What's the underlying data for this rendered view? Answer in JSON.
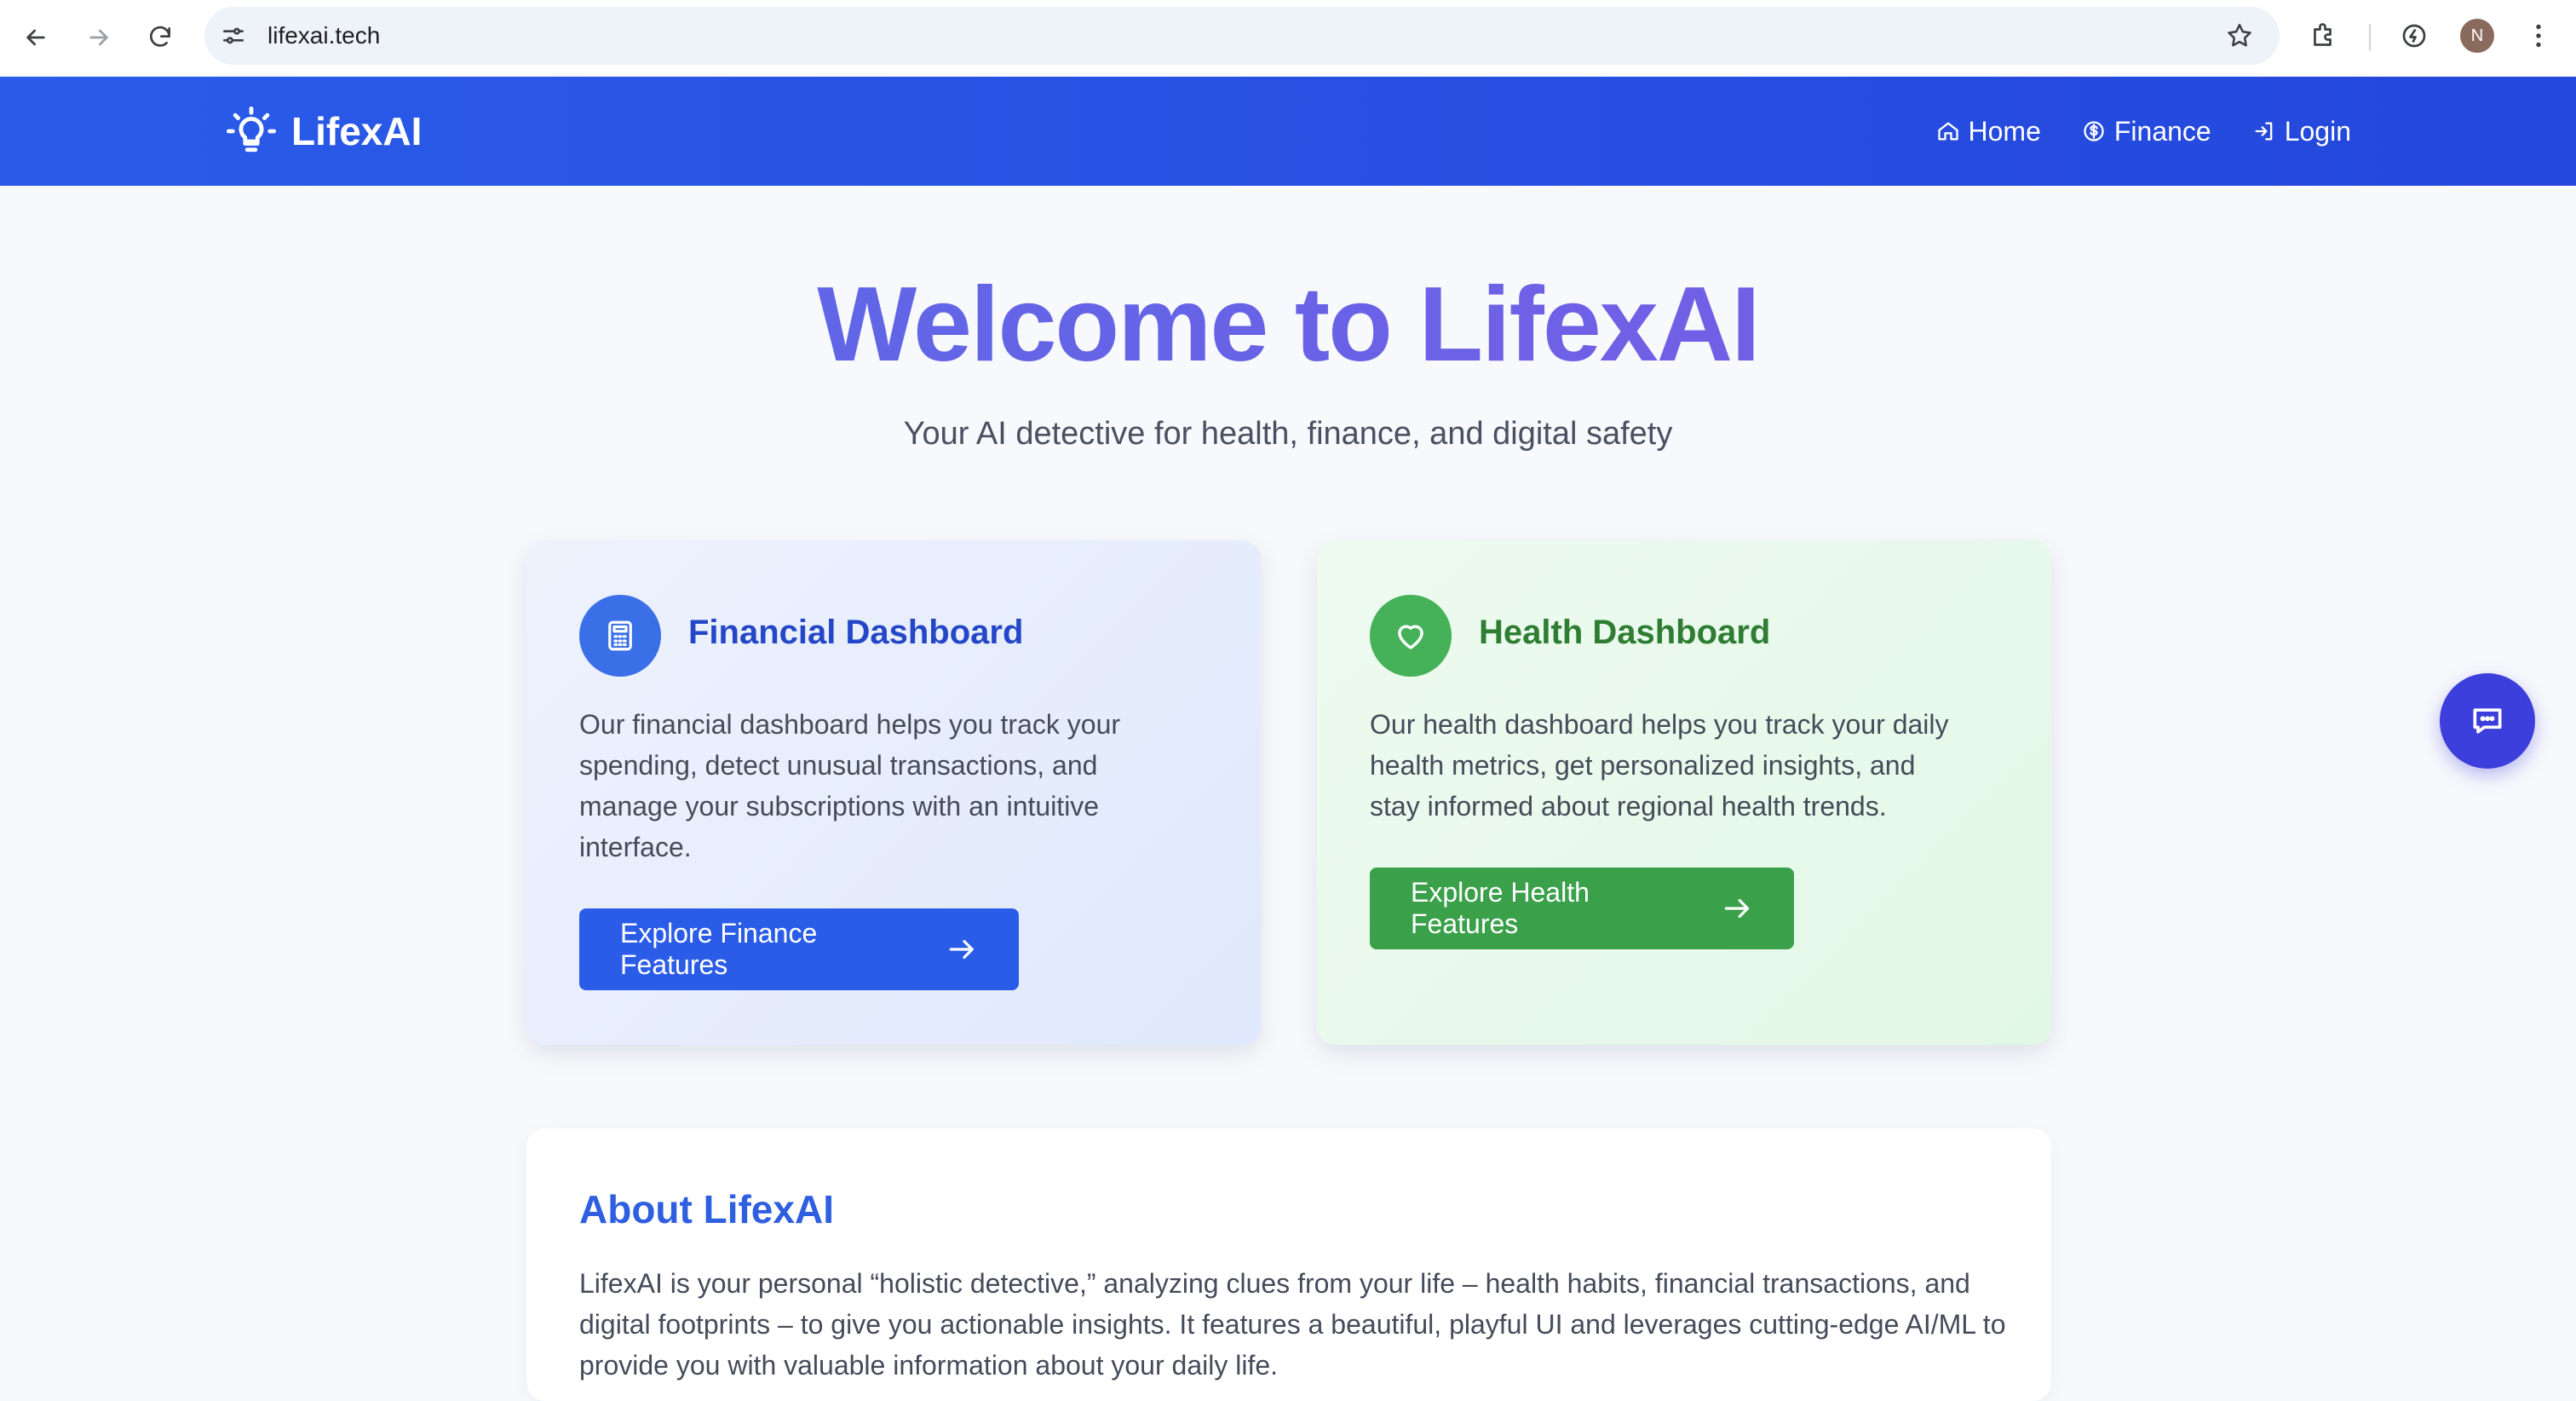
{
  "browser": {
    "url": "lifexai.tech",
    "profile_initial": "N",
    "icons": [
      "back-icon",
      "forward-icon",
      "reload-icon",
      "site-settings-icon",
      "bookmark-star-icon",
      "extensions-icon",
      "performance-icon",
      "kebab-menu-icon"
    ]
  },
  "nav": {
    "brand": "LifexAI",
    "links": [
      {
        "label": "Home",
        "icon": "home-icon"
      },
      {
        "label": "Finance",
        "icon": "dollar-circle-icon"
      },
      {
        "label": "Login",
        "icon": "login-icon"
      }
    ]
  },
  "hero": {
    "title": "Welcome to LifexAI",
    "subtitle": "Your AI detective for health, finance, and digital safety"
  },
  "cards": {
    "finance": {
      "title": "Financial Dashboard",
      "description": "Our financial dashboard helps you track your spending, detect unusual transactions, and manage your subscriptions with an intuitive interface.",
      "cta": "Explore Finance Features",
      "icon": "calculator-icon"
    },
    "health": {
      "title": "Health Dashboard",
      "description": "Our health dashboard helps you track your daily health metrics, get personalized insights, and stay informed about regional health trends.",
      "cta": "Explore Health Features",
      "icon": "heart-icon"
    }
  },
  "about": {
    "title": "About LifexAI",
    "text": "LifexAI is your personal “holistic detective,” analyzing clues from your life – health habits, financial transactions, and digital footprints – to give you actionable insights. It features a beautiful, playful UI and leverages cutting-edge AI/ML to provide you with valuable information about your daily life."
  },
  "colors": {
    "appbar": "#2b5be8",
    "finance_accent": "#2a5ce8",
    "health_accent": "#3aa04a",
    "chat_fab": "#3d3fdc"
  }
}
